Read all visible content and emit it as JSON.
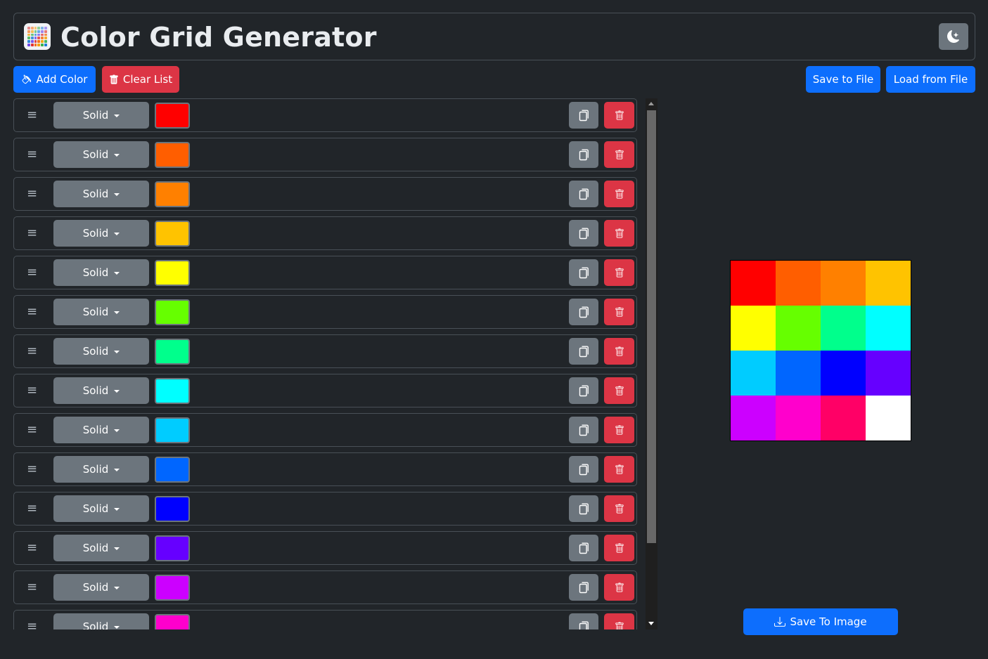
{
  "header": {
    "title": "Color Grid Generator",
    "logo_icon": "color-palette-icon",
    "theme_toggle_icon": "moon-stars-icon"
  },
  "toolbar": {
    "add_color_label": "Add Color",
    "add_color_icon": "paint-bucket-icon",
    "clear_list_label": "Clear List",
    "clear_list_icon": "trash-icon",
    "save_file_label": "Save to File",
    "load_file_label": "Load from File"
  },
  "colors": [
    {
      "type": "Solid",
      "color": "#ff0000"
    },
    {
      "type": "Solid",
      "color": "#ff5e00"
    },
    {
      "type": "Solid",
      "color": "#ff8000"
    },
    {
      "type": "Solid",
      "color": "#ffc300"
    },
    {
      "type": "Solid",
      "color": "#ffff00"
    },
    {
      "type": "Solid",
      "color": "#66ff00"
    },
    {
      "type": "Solid",
      "color": "#00ff8c"
    },
    {
      "type": "Solid",
      "color": "#00ffff"
    },
    {
      "type": "Solid",
      "color": "#00ccff"
    },
    {
      "type": "Solid",
      "color": "#0066ff"
    },
    {
      "type": "Solid",
      "color": "#0000ff"
    },
    {
      "type": "Solid",
      "color": "#6600ff"
    },
    {
      "type": "Solid",
      "color": "#cc00ff"
    },
    {
      "type": "Solid",
      "color": "#ff00cc"
    }
  ],
  "grid_colors": [
    "#ff0000",
    "#ff5e00",
    "#ff8000",
    "#ffc300",
    "#ffff00",
    "#66ff00",
    "#00ff8c",
    "#00ffff",
    "#00ccff",
    "#0066ff",
    "#0000ff",
    "#6600ff",
    "#cc00ff",
    "#ff00cc",
    "#ff0066",
    "#ffffff"
  ],
  "save_image": {
    "label": "Save To Image",
    "icon": "download-icon"
  },
  "theme": {
    "primary": "#0d6efd",
    "danger": "#dc3545",
    "secondary": "#6c757d",
    "background": "#212529"
  }
}
